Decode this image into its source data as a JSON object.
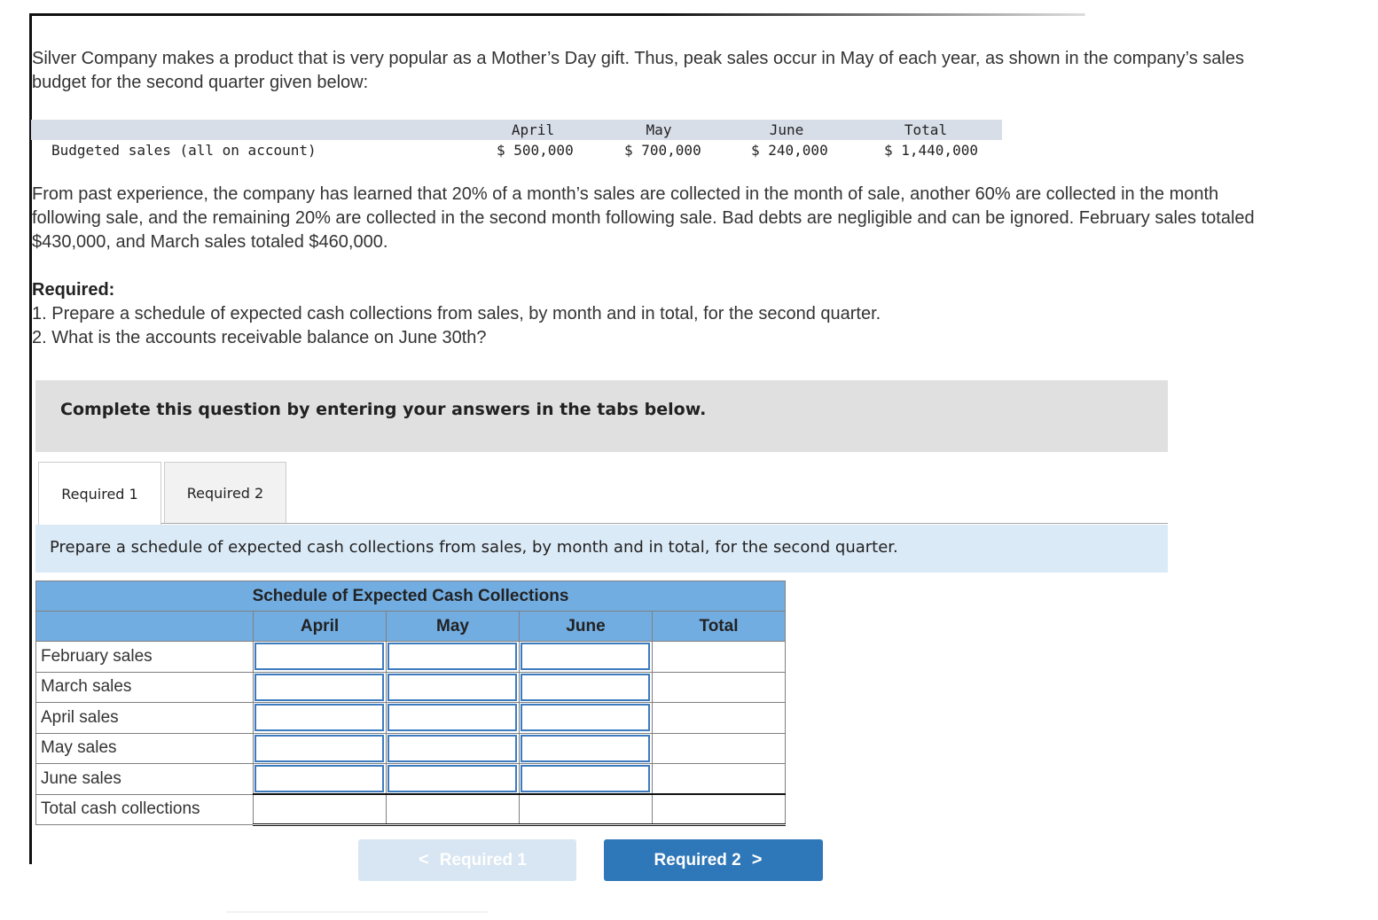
{
  "problem": {
    "intro": "Silver Company makes a product that is very popular as a Mother’s Day gift. Thus, peak sales occur in May of each year, as shown in the company’s sales budget for the second quarter given below:",
    "budget_table": {
      "headers": [
        "April",
        "May",
        "June",
        "Total"
      ],
      "row_label": "Budgeted sales (all on account)",
      "values": [
        "$ 500,000",
        "$ 700,000",
        "$ 240,000",
        "$ 1,440,000"
      ]
    },
    "collection_text": "From past experience, the company has learned that 20% of a month’s sales are collected in the month of sale, another 60% are collected in the month following sale, and the remaining 20% are collected in the second month following sale. Bad debts are negligible and can be ignored. February sales totaled $430,000, and March sales totaled $460,000.",
    "required_heading": "Required:",
    "required_items": [
      "1. Prepare a schedule of expected cash collections from sales, by month and in total, for the second quarter.",
      "2. What is the accounts receivable balance on June 30th?"
    ]
  },
  "instructions": "Complete this question by entering your answers in the tabs below.",
  "tabs": [
    {
      "label": "Required 1",
      "active": true
    },
    {
      "label": "Required 2",
      "active": false
    }
  ],
  "tab_prompt": "Prepare a schedule of expected cash collections from sales, by month and in total, for the second quarter.",
  "schedule": {
    "title": "Schedule of Expected Cash Collections",
    "columns": [
      "April",
      "May",
      "June",
      "Total"
    ],
    "rows": [
      {
        "label": "February sales",
        "values": [
          "",
          "",
          "",
          ""
        ]
      },
      {
        "label": "March sales",
        "values": [
          "",
          "",
          "",
          ""
        ]
      },
      {
        "label": "April sales",
        "values": [
          "",
          "",
          "",
          ""
        ]
      },
      {
        "label": "May sales",
        "values": [
          "",
          "",
          "",
          ""
        ]
      },
      {
        "label": "June sales",
        "values": [
          "",
          "",
          "",
          ""
        ]
      },
      {
        "label": "Total cash collections",
        "values": [
          "",
          "",
          "",
          ""
        ]
      }
    ]
  },
  "nav": {
    "prev_label": "Required 1",
    "prev_enabled": false,
    "next_label": "Required 2",
    "next_enabled": true
  },
  "colors": {
    "accent": "#2e77b8",
    "header_blue": "#72ade2",
    "prompt_bg": "#dbeaf7"
  }
}
